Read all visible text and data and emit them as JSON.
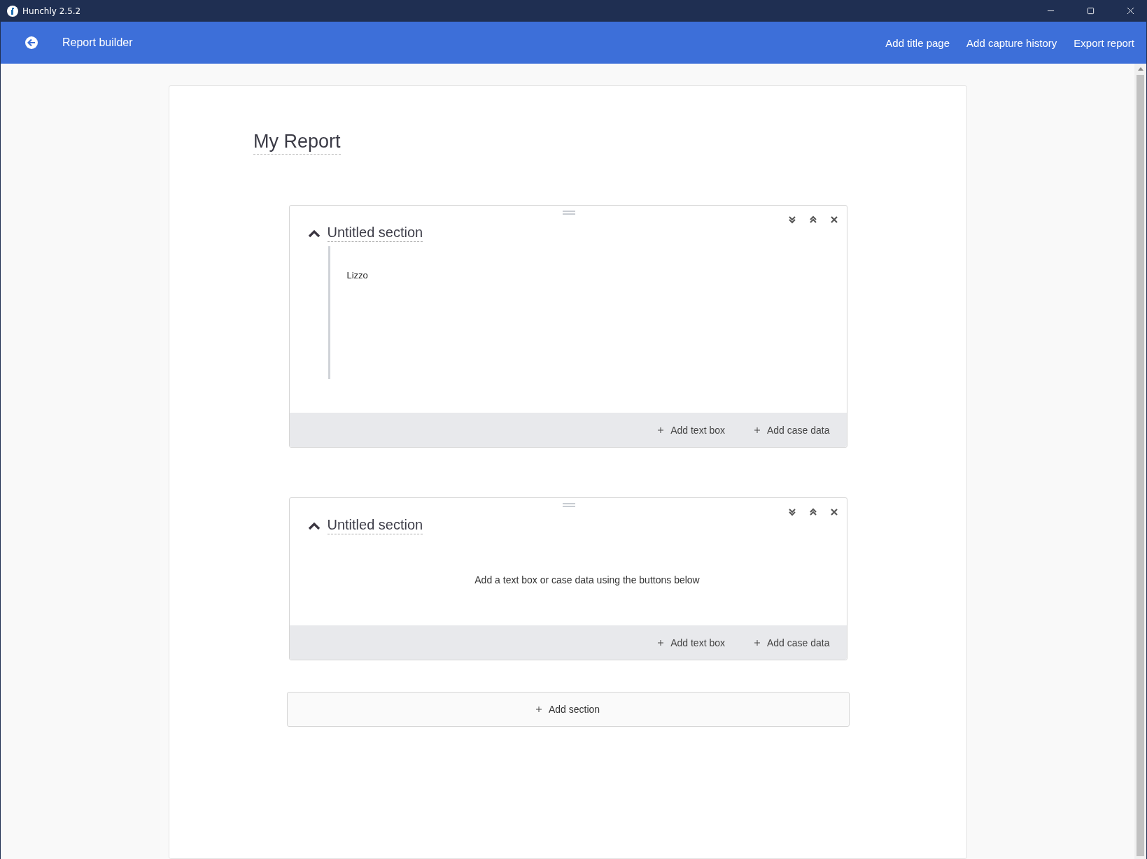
{
  "window": {
    "title": "Hunchly 2.5.2"
  },
  "header": {
    "title": "Report builder",
    "actions": [
      "Add title page",
      "Add capture history",
      "Export report"
    ]
  },
  "report": {
    "title": "My Report",
    "sections": [
      {
        "title": "Untitled section",
        "expanded": true,
        "text_boxes": [
          "Lizzo"
        ],
        "actions": [
          "Add text box",
          "Add case data"
        ]
      },
      {
        "title": "Untitled section",
        "expanded": true,
        "empty_message": "Add a text box or case data using the buttons below",
        "actions": [
          "Add text box",
          "Add case data"
        ]
      }
    ],
    "add_section": "Add section"
  }
}
